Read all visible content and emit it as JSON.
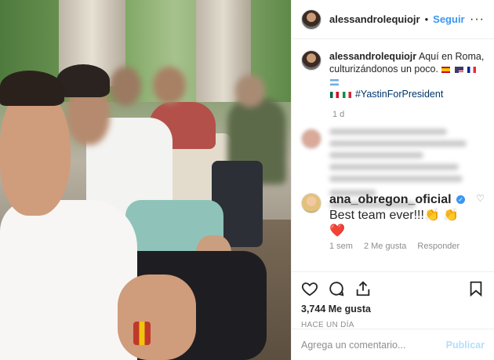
{
  "post": {
    "username": "alessandrolequiojr",
    "follow_label": "Seguir",
    "more_icon": "more-horizontal-icon"
  },
  "caption": {
    "username": "alessandrolequiojr",
    "text": "Aquí en Roma, culturizándonos un poco.",
    "hashtag": "#YastinForPresident",
    "flags": [
      "es",
      "us",
      "fr",
      "ar",
      "mx",
      "it"
    ],
    "time": "1 d"
  },
  "comment_ana": {
    "username": "ana_obregon_oficial",
    "text": "Best team ever!!!👏 👏 ❤️",
    "likes": "2 Me gusta",
    "reply_label": "Responder",
    "time": "1 sem"
  },
  "actions": {
    "likes": "3,744 Me gusta",
    "date": "HACE UN DÍA"
  },
  "add_comment": {
    "placeholder": "Agrega un comentario...",
    "publish_label": "Publicar"
  },
  "colors": {
    "link": "#3897f0",
    "hashtag": "#003569",
    "muted": "#8e8e8e",
    "publish_disabled": "#b2dffc"
  }
}
